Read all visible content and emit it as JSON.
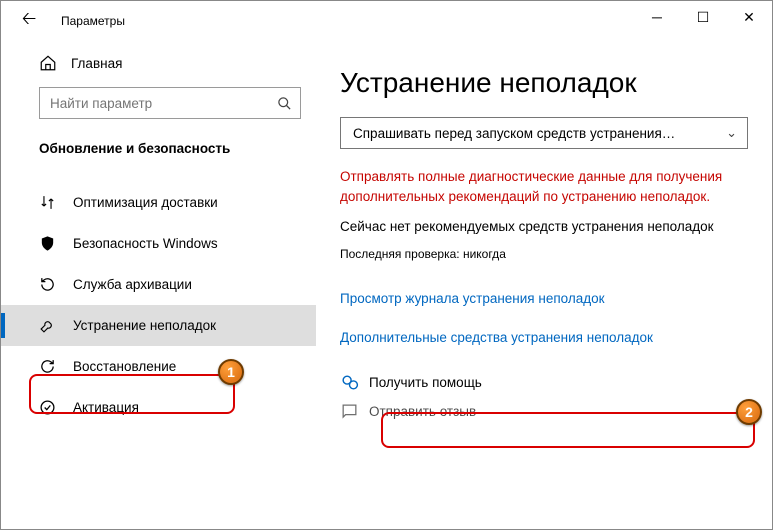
{
  "window": {
    "title": "Параметры"
  },
  "sidebar": {
    "home": "Главная",
    "search_placeholder": "Найти параметр",
    "section": "Обновление и безопасность",
    "items": [
      {
        "label": "Оптимизация доставки",
        "glyph": "⇅"
      },
      {
        "label": "Безопасность Windows",
        "glyph": "shield"
      },
      {
        "label": "Служба архивации",
        "glyph": "↶"
      },
      {
        "label": "Устранение неполадок",
        "glyph": "wrench",
        "active": true
      },
      {
        "label": "Восстановление",
        "glyph": "↻"
      },
      {
        "label": "Активация",
        "glyph": "✓"
      }
    ]
  },
  "main": {
    "title": "Устранение неполадок",
    "dropdown_value": "Спрашивать перед запуском средств устранения…",
    "red_notice": "Отправлять полные диагностические данные для получения дополнительных рекомендаций по устранению неполадок.",
    "no_rec": "Сейчас нет рекомендуемых средств устранения неполадок",
    "last_check": "Последняя проверка: никогда",
    "link_history": "Просмотр журнала устранения неполадок",
    "link_additional": "Дополнительные средства устранения неполадок",
    "help": "Получить помощь",
    "feedback": "Отправить отзыв"
  },
  "annotations": {
    "1": "1",
    "2": "2"
  }
}
